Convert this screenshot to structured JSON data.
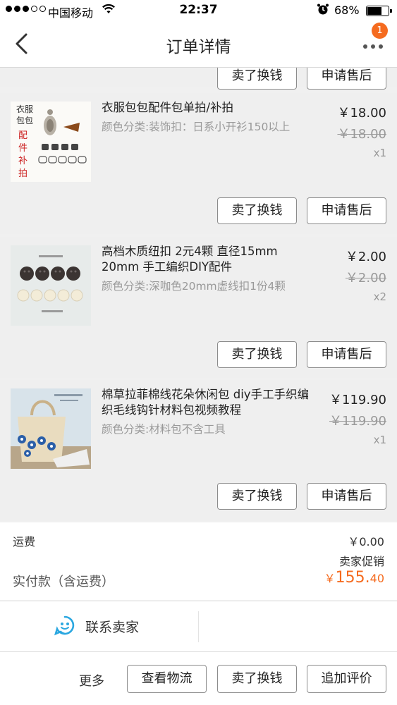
{
  "status_bar": {
    "carrier": "中国移动",
    "time": "22:37",
    "battery": "68%",
    "battery_level": 0.68
  },
  "nav": {
    "title": "订单详情",
    "badge": "1"
  },
  "prev_item": {
    "sell_btn": "卖了换钱",
    "service_btn": "申请售后"
  },
  "items": [
    {
      "thumb_text": [
        "衣服",
        "包包",
        "配件",
        "补拍"
      ],
      "name": "衣服包包配件包单拍/补拍",
      "spec": "颜色分类:装饰扣：日系小开衫150以上",
      "price": "￥18.00",
      "original_price": "￥18.00",
      "qty": "x1",
      "sell_btn": "卖了换钱",
      "service_btn": "申请售后"
    },
    {
      "name": "高档木质纽扣 2元4颗 直径15mm 20mm 手工编织DIY配件",
      "spec": "颜色分类:深咖色20mm虚线扣1份4颗",
      "price": "￥2.00",
      "original_price": "￥2.00",
      "qty": "x2",
      "sell_btn": "卖了换钱",
      "service_btn": "申请售后"
    },
    {
      "name": "棉草拉菲棉线花朵休闲包 diy手工手织编织毛线钩针材料包视频教程",
      "spec": "颜色分类:材料包不含工具",
      "price": "￥119.90",
      "original_price": "￥119.90",
      "qty": "x1",
      "sell_btn": "卖了换钱",
      "service_btn": "申请售后"
    }
  ],
  "summary": {
    "shipping_label": "运费",
    "shipping_value": "￥0.00",
    "promo": "卖家促销",
    "total_label": "实付款（含运费）",
    "total_symbol": "￥",
    "total_int": "155.",
    "total_dec": "40"
  },
  "contact": {
    "label": "联系卖家"
  },
  "bottom_bar": {
    "more": "更多",
    "logistics_btn": "查看物流",
    "sell_btn": "卖了换钱",
    "review_btn": "追加评价"
  },
  "colors": {
    "accent": "#f56b1f",
    "contact_icon": "#2aa7e0"
  }
}
